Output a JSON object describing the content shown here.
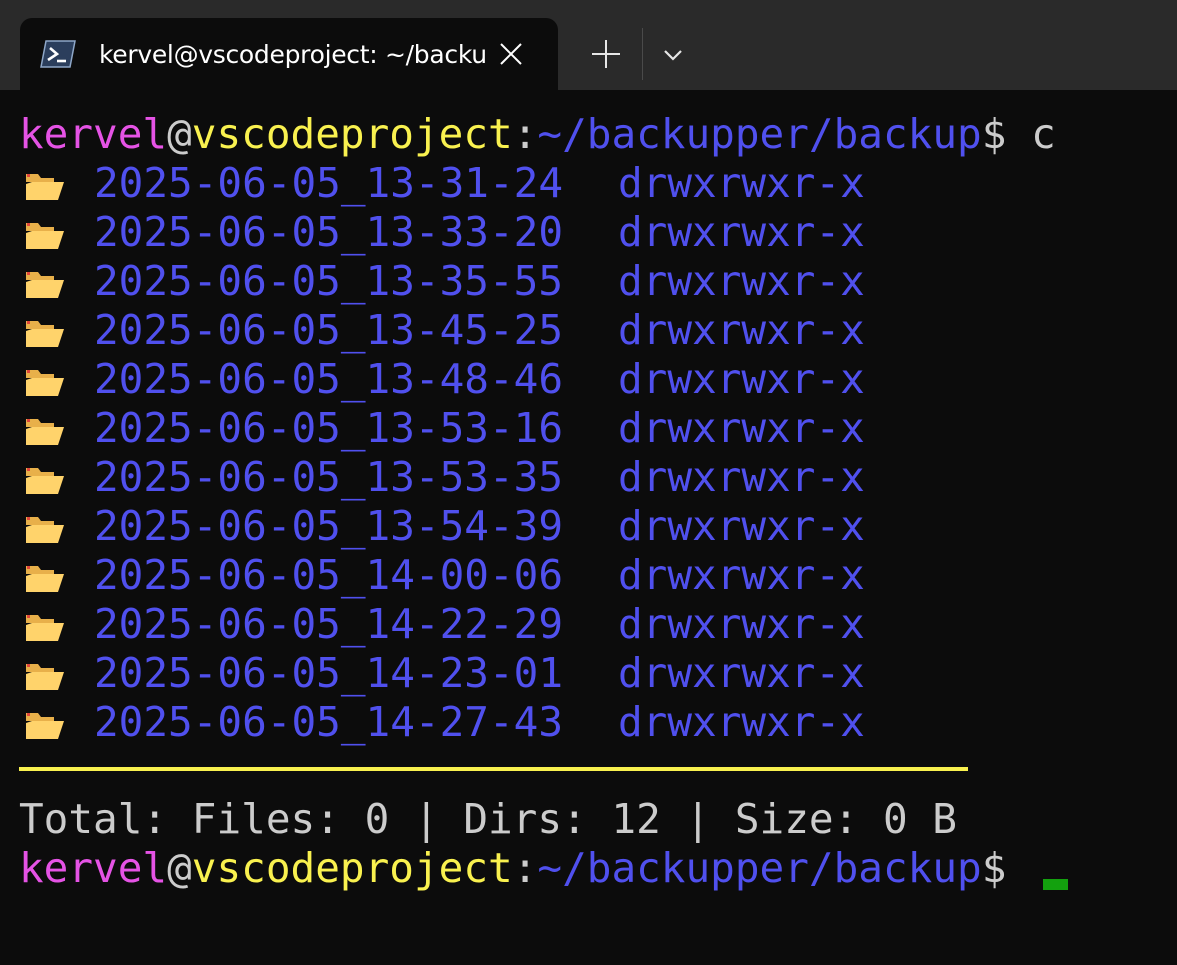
{
  "tab": {
    "title": "kervel@vscodeproject: ~/backupper/backup",
    "icon": "powershell-icon",
    "close_icon": "close-icon",
    "new_tab_icon": "plus-icon",
    "dropdown_icon": "chevron-down-icon"
  },
  "prompt": {
    "user": "kervel",
    "at": "@",
    "host": "vscodeproject",
    "colon": ":",
    "path": "~/backupper/backup",
    "symbol": "$",
    "command": " c"
  },
  "entries": [
    {
      "name": "2025-06-05_13-31-24",
      "perm": "drwxrwxr-x"
    },
    {
      "name": "2025-06-05_13-33-20",
      "perm": "drwxrwxr-x"
    },
    {
      "name": "2025-06-05_13-35-55",
      "perm": "drwxrwxr-x"
    },
    {
      "name": "2025-06-05_13-45-25",
      "perm": "drwxrwxr-x"
    },
    {
      "name": "2025-06-05_13-48-46",
      "perm": "drwxrwxr-x"
    },
    {
      "name": "2025-06-05_13-53-16",
      "perm": "drwxrwxr-x"
    },
    {
      "name": "2025-06-05_13-53-35",
      "perm": "drwxrwxr-x"
    },
    {
      "name": "2025-06-05_13-54-39",
      "perm": "drwxrwxr-x"
    },
    {
      "name": "2025-06-05_14-00-06",
      "perm": "drwxrwxr-x"
    },
    {
      "name": "2025-06-05_14-22-29",
      "perm": "drwxrwxr-x"
    },
    {
      "name": "2025-06-05_14-23-01",
      "perm": "drwxrwxr-x"
    },
    {
      "name": "2025-06-05_14-27-43",
      "perm": "drwxrwxr-x"
    }
  ],
  "summary": "Total: Files: 0 | Dirs: 12 | Size: 0 B",
  "colors": {
    "user": "#e553e5",
    "host": "#f9f14f",
    "path": "#5050ee",
    "text": "#cccccc",
    "cursor": "#13a10e",
    "folder": "#ffd36b"
  }
}
